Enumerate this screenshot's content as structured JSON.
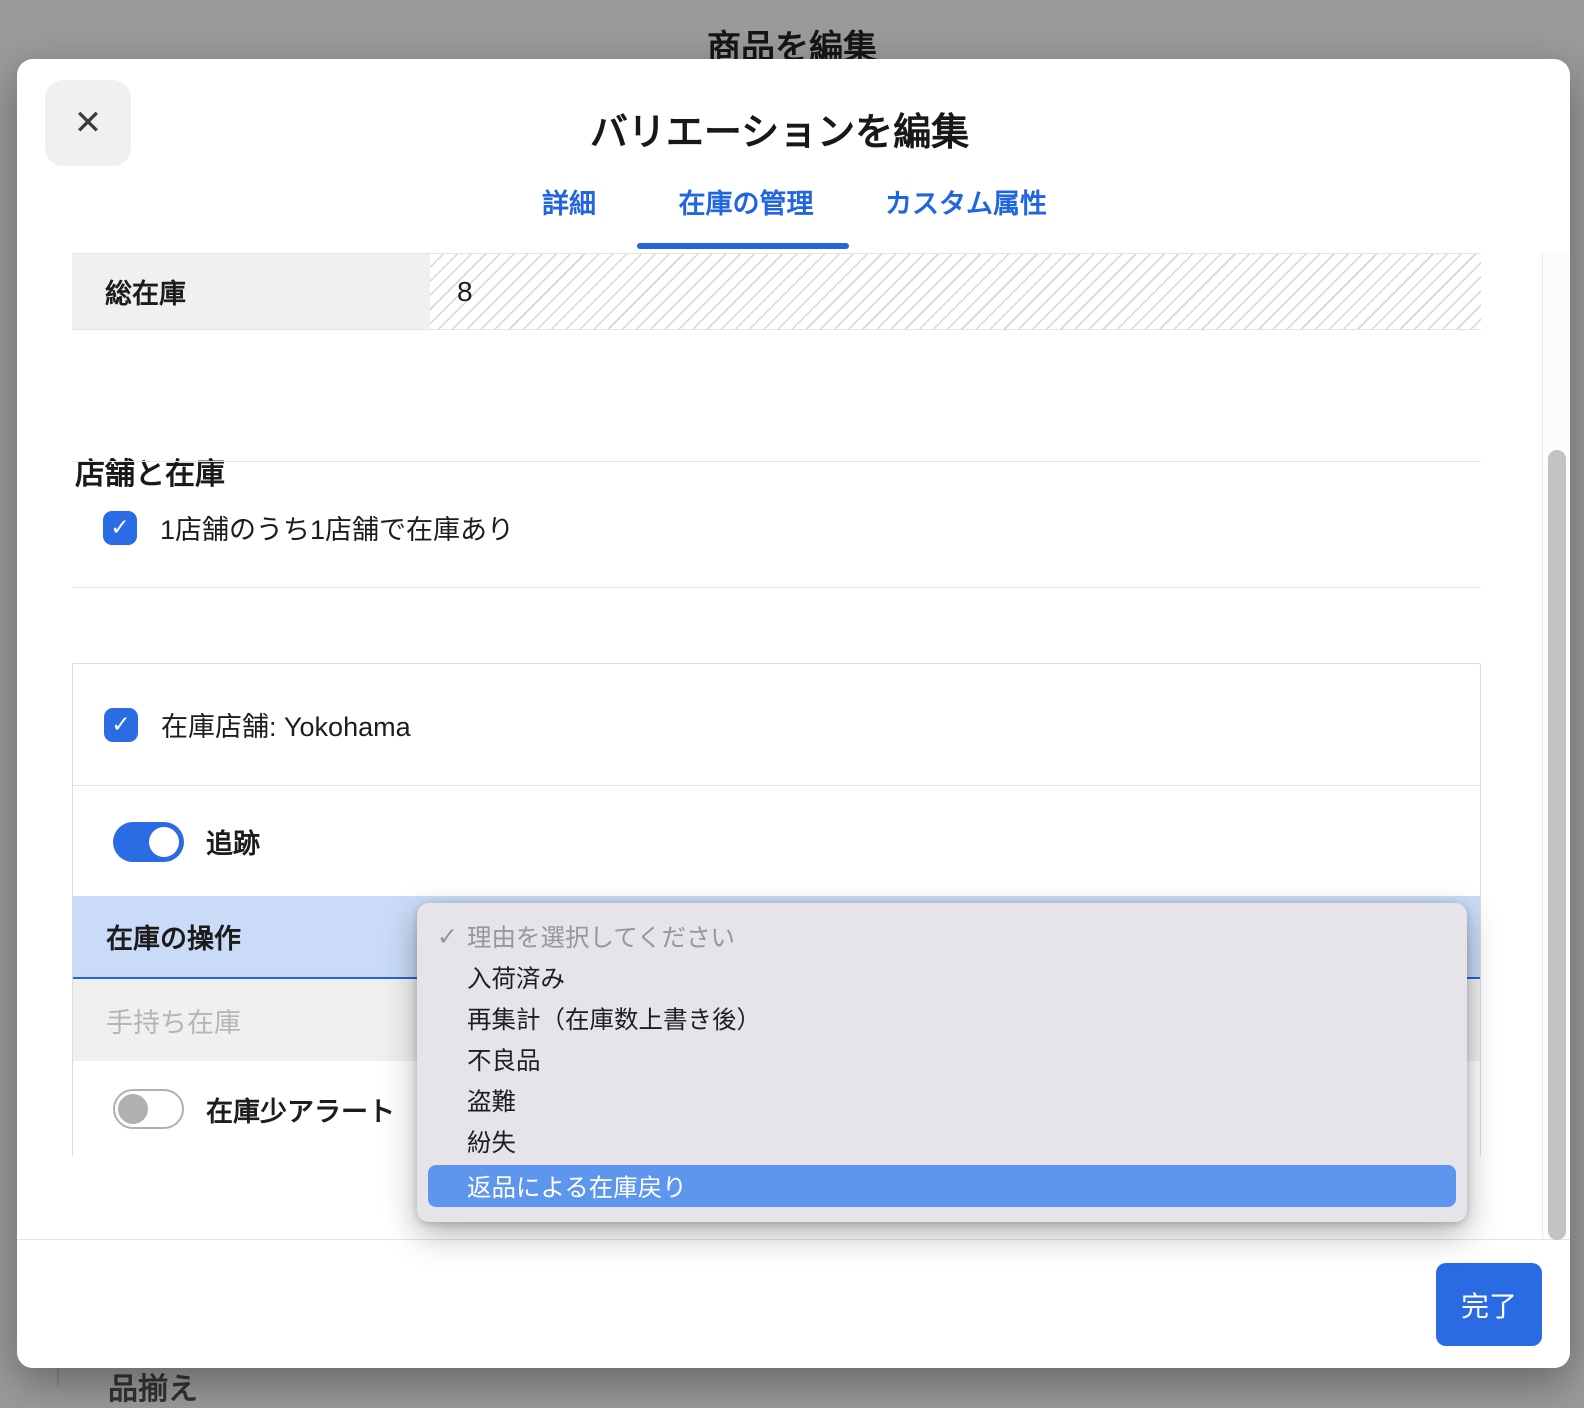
{
  "icons": {
    "check": "✓",
    "close": "✕"
  },
  "background_page": {
    "title": "商品を編集",
    "partial_bottom_text": "品揃え"
  },
  "modal": {
    "title": "バリエーションを編集",
    "tabs": [
      {
        "label": "詳細",
        "active": false
      },
      {
        "label": "在庫の管理",
        "active": true
      },
      {
        "label": "カスタム属性",
        "active": false
      }
    ],
    "total_inventory_row": {
      "label": "総在庫",
      "value": "8"
    },
    "stores_section": {
      "heading": "店舗と在庫",
      "availability_checkbox": {
        "label": "1店舗のうち1店舗で在庫あり",
        "checked": true
      },
      "store_card": {
        "store_checkbox": {
          "label": "在庫店舗: Yokohama",
          "checked": true
        },
        "tracking_toggle": {
          "label": "追跡",
          "state": "on"
        },
        "stock_action_row": {
          "label": "在庫の操作"
        },
        "on_hand_row": {
          "label": "手持ち在庫"
        },
        "low_stock_toggle": {
          "label": "在庫少アラート",
          "state": "off"
        }
      }
    },
    "reason_dropdown": {
      "options": [
        {
          "label": "理由を選択してください",
          "selected": true,
          "placeholder": true
        },
        {
          "label": "入荷済み"
        },
        {
          "label": "再集計（在庫数上書き後）"
        },
        {
          "label": "不良品"
        },
        {
          "label": "盗難"
        },
        {
          "label": "紛失"
        },
        {
          "label": "返品による在庫戻り",
          "highlighted": true
        }
      ]
    },
    "footer": {
      "done_button": "完了"
    }
  },
  "colors": {
    "accent_blue": "#2a6ae3",
    "focus_blue": "#2264e0",
    "selected_row_bg": "#c9dbf7",
    "dropdown_bg": "#e6e4e9",
    "dropdown_highlight_bg": "#5e96ee",
    "muted_text": "#b6b4b7",
    "row_gray_bg": "#f1f0f1",
    "backdrop": "#9b9b9b"
  }
}
